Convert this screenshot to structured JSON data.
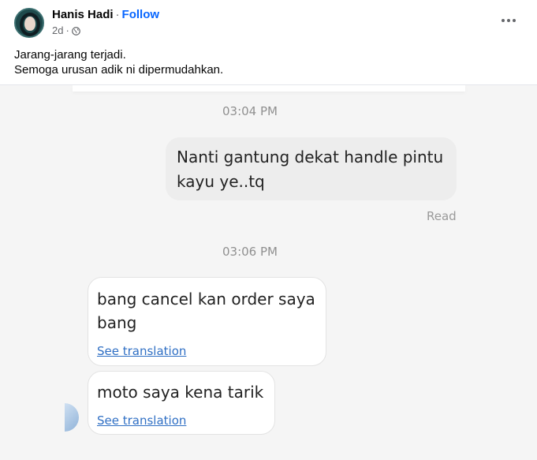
{
  "post": {
    "author": "Hanis Hadi",
    "separator": "·",
    "follow_label": "Follow",
    "time": "2d",
    "meta_dot": "·",
    "privacy_icon": "globe-icon",
    "more_icon": "more-options-icon",
    "caption_line1": "Jarang-jarang terjadi.",
    "caption_line2": "Semoga urusan adik ni dipermudahkan."
  },
  "chat": {
    "time1": "03:04 PM",
    "out_line1": "Nanti gantung dekat handle pintu",
    "out_line2": "kayu ye..tq",
    "read_label": "Read",
    "time2": "03:06 PM",
    "in1_line1": "bang cancel kan order saya",
    "in1_line2": "bang",
    "in1_translate": "See translation",
    "in2_text": "moto saya kena tarik",
    "in2_translate": "See translation"
  }
}
